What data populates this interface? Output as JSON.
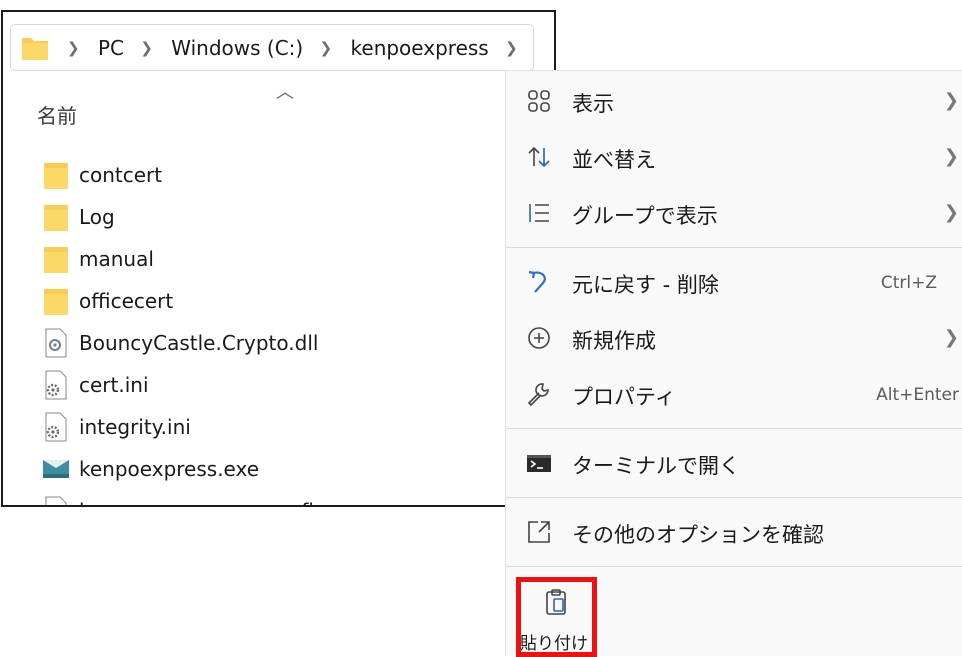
{
  "explorer": {
    "breadcrumb": [
      "PC",
      "Windows (C:)",
      "kenpoexpress"
    ],
    "column_header": "名前",
    "files": [
      {
        "name": "contcert",
        "icon": "folder-icon"
      },
      {
        "name": "Log",
        "icon": "folder-icon"
      },
      {
        "name": "manual",
        "icon": "folder-icon"
      },
      {
        "name": "officecert",
        "icon": "folder-icon"
      },
      {
        "name": "BouncyCastle.Crypto.dll",
        "icon": "dll-file-icon"
      },
      {
        "name": "cert.ini",
        "icon": "settings-file-icon"
      },
      {
        "name": "integrity.ini",
        "icon": "settings-file-icon"
      },
      {
        "name": "kenpoexpress.exe",
        "icon": "exe-app-icon"
      },
      {
        "name": "kenpoexpress.exe.config",
        "icon": "blank-file-icon"
      }
    ]
  },
  "context_menu": {
    "items": [
      {
        "label": "表示",
        "icon": "view-grid-icon",
        "submenu": true
      },
      {
        "label": "並べ替え",
        "icon": "sort-arrows-icon",
        "submenu": true
      },
      {
        "label": "グループで表示",
        "icon": "group-list-icon",
        "submenu": true
      },
      {
        "label": "元に戻す - 削除",
        "icon": "undo-icon",
        "shortcut": "Ctrl+Z"
      },
      {
        "label": "新規作成",
        "icon": "new-plus-icon",
        "submenu": true
      },
      {
        "label": "プロパティ",
        "icon": "wrench-icon",
        "shortcut": "Alt+Enter"
      },
      {
        "label": "ターミナルで開く",
        "icon": "terminal-icon"
      },
      {
        "label": "その他のオプションを確認",
        "icon": "more-options-icon"
      }
    ],
    "paste_label": "貼り付け",
    "highlight_color": "#ee1111"
  }
}
